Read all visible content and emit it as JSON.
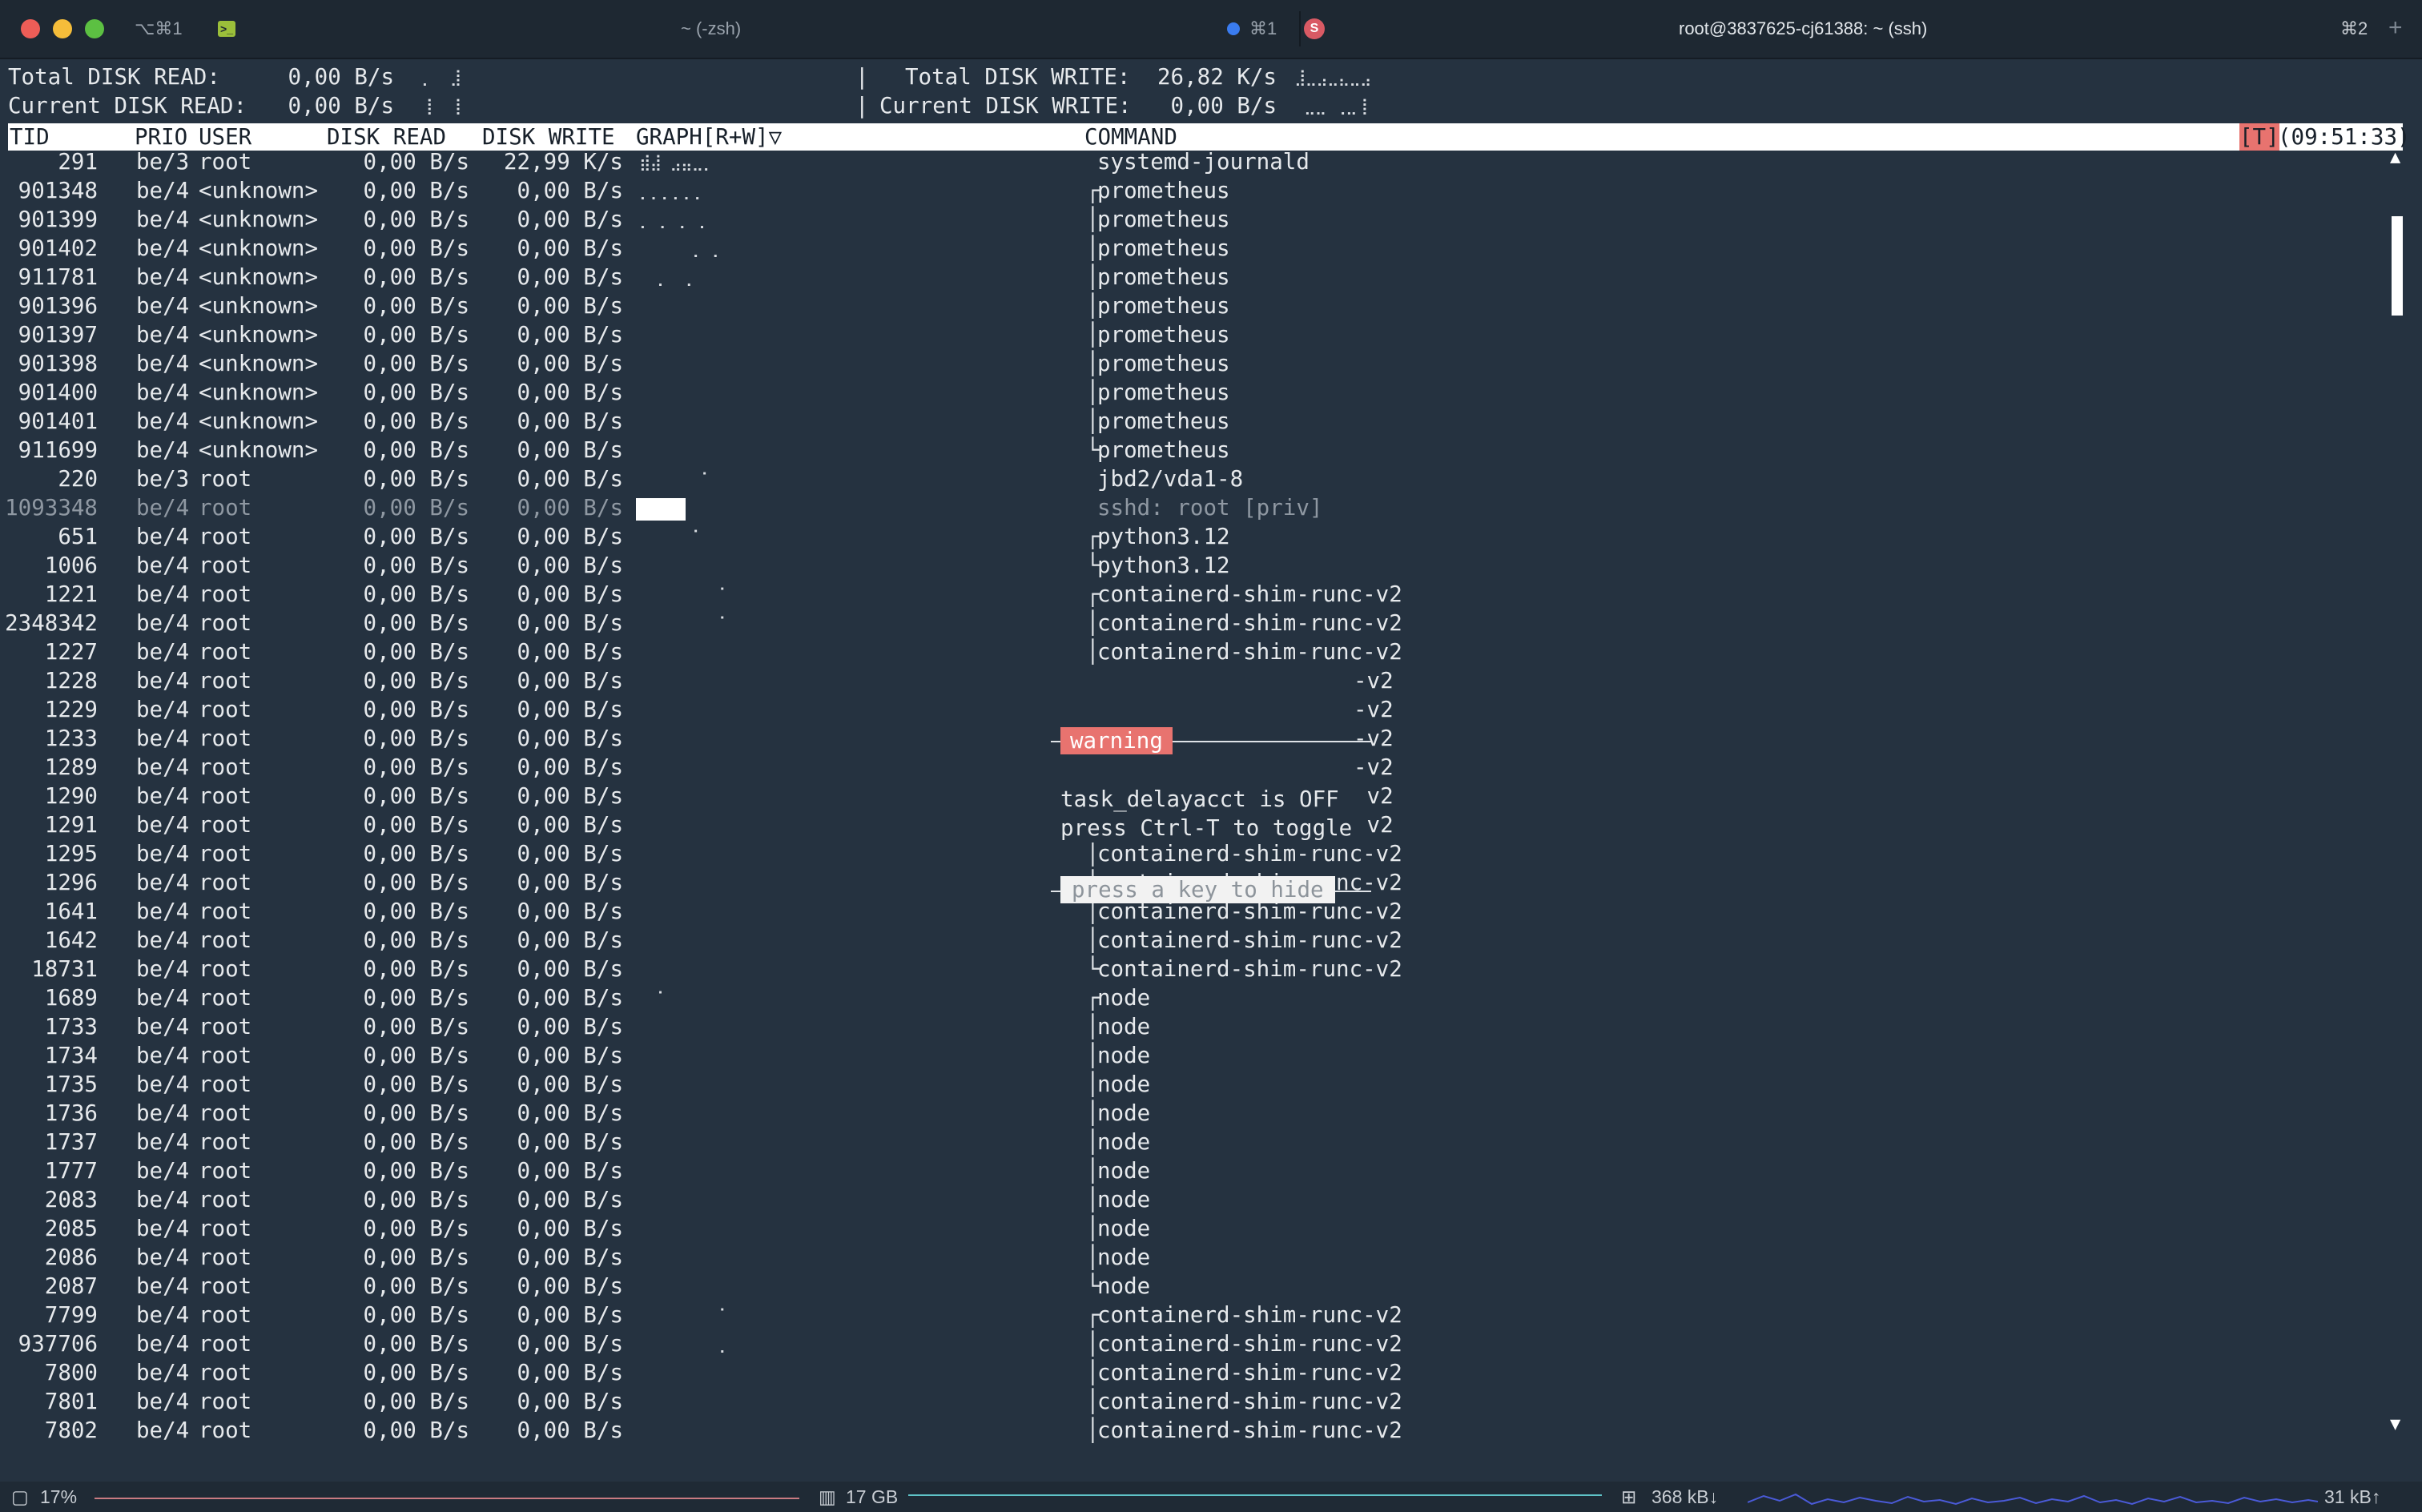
{
  "window": {
    "tab1": {
      "shortcut": "⌥⌘1",
      "title": "~ (-zsh)",
      "badge": "⌘1"
    },
    "tab2": {
      "title": "root@3837625-cj61388: ~ (ssh)",
      "badge": "⌘2"
    },
    "add_tab": "+"
  },
  "summary": {
    "total_read_label": "Total DISK READ:",
    "total_read": "0,00 B/s",
    "current_read_label": "Current DISK READ:",
    "current_read": "0,00 B/s",
    "total_write_label": "Total DISK WRITE:",
    "total_write": "26,82 K/s",
    "current_write_label": "Current DISK WRITE:",
    "current_write": "0,00 B/s",
    "sep": "|"
  },
  "header": {
    "tid": "TID",
    "prio": "PRIO",
    "user": "USER",
    "disk_read": "DISK READ",
    "disk_write": "DISK WRITE",
    "graph": "GRAPH[R+W]▽",
    "command": "COMMAND",
    "toggle": "[T]",
    "time": "(09:51:33)"
  },
  "rows": [
    {
      "tid": "291",
      "prio": "be/3",
      "user": "root",
      "read": "0,00 B/s",
      "write": "22,99 K/s",
      "graph": "⣾⣼ ⣠⣤⣀⡀",
      "cmd": "systemd-journald",
      "tree": ""
    },
    {
      "tid": "901348",
      "prio": "be/4",
      "user": "<unknown>",
      "read": "0,00 B/s",
      "write": "0,00 B/s",
      "graph": "⡀⡀⡀⡀⡀⡀",
      "cmd": "prometheus",
      "tree": "┌"
    },
    {
      "tid": "901399",
      "prio": "be/4",
      "user": "<unknown>",
      "read": "0,00 B/s",
      "write": "0,00 B/s",
      "graph": "⡀ ⡀ ⡀ ⡀",
      "cmd": "prometheus",
      "tree": "│"
    },
    {
      "tid": "901402",
      "prio": "be/4",
      "user": "<unknown>",
      "read": "0,00 B/s",
      "write": "0,00 B/s",
      "graph": "      ⡀ ⡀",
      "cmd": "prometheus",
      "tree": "│"
    },
    {
      "tid": "911781",
      "prio": "be/4",
      "user": "<unknown>",
      "read": "0,00 B/s",
      "write": "0,00 B/s",
      "graph": "  ⡀  ⡀",
      "cmd": "prometheus",
      "tree": "│"
    },
    {
      "tid": "901396",
      "prio": "be/4",
      "user": "<unknown>",
      "read": "0,00 B/s",
      "write": "0,00 B/s",
      "graph": "",
      "cmd": "prometheus",
      "tree": "│"
    },
    {
      "tid": "901397",
      "prio": "be/4",
      "user": "<unknown>",
      "read": "0,00 B/s",
      "write": "0,00 B/s",
      "graph": "",
      "cmd": "prometheus",
      "tree": "│"
    },
    {
      "tid": "901398",
      "prio": "be/4",
      "user": "<unknown>",
      "read": "0,00 B/s",
      "write": "0,00 B/s",
      "graph": "",
      "cmd": "prometheus",
      "tree": "│"
    },
    {
      "tid": "901400",
      "prio": "be/4",
      "user": "<unknown>",
      "read": "0,00 B/s",
      "write": "0,00 B/s",
      "graph": "",
      "cmd": "prometheus",
      "tree": "│"
    },
    {
      "tid": "901401",
      "prio": "be/4",
      "user": "<unknown>",
      "read": "0,00 B/s",
      "write": "0,00 B/s",
      "graph": "",
      "cmd": "prometheus",
      "tree": "│"
    },
    {
      "tid": "911699",
      "prio": "be/4",
      "user": "<unknown>",
      "read": "0,00 B/s",
      "write": "0,00 B/s",
      "graph": "",
      "cmd": "prometheus",
      "tree": "└"
    },
    {
      "tid": "220",
      "prio": "be/3",
      "user": "root",
      "read": "0,00 B/s",
      "write": "0,00 B/s",
      "graph": "       ⠁",
      "cmd": "jbd2/vda1-8",
      "tree": ""
    },
    {
      "tid": "1093348",
      "prio": "be/4",
      "user": "root",
      "read": "0,00 B/s",
      "write": "0,00 B/s",
      "graph": "",
      "cmd": "sshd: root [priv]",
      "tree": "",
      "dim": true,
      "block": true
    },
    {
      "tid": "651",
      "prio": "be/4",
      "user": "root",
      "read": "0,00 B/s",
      "write": "0,00 B/s",
      "graph": "      ⠁",
      "cmd": "python3.12",
      "tree": "┌"
    },
    {
      "tid": "1006",
      "prio": "be/4",
      "user": "root",
      "read": "0,00 B/s",
      "write": "0,00 B/s",
      "graph": "",
      "cmd": "python3.12",
      "tree": "└"
    },
    {
      "tid": "1221",
      "prio": "be/4",
      "user": "root",
      "read": "0,00 B/s",
      "write": "0,00 B/s",
      "graph": "         ⠁",
      "cmd": "containerd-shim-runc-v2",
      "tree": "┌"
    },
    {
      "tid": "2348342",
      "prio": "be/4",
      "user": "root",
      "read": "0,00 B/s",
      "write": "0,00 B/s",
      "graph": "         ⠁",
      "cmd": "containerd-shim-runc-v2",
      "tree": "│"
    },
    {
      "tid": "1227",
      "prio": "be/4",
      "user": "root",
      "read": "0,00 B/s",
      "write": "0,00 B/s",
      "graph": "",
      "cmd": "containerd-shim-runc-v2",
      "tree": "│"
    },
    {
      "tid": "1228",
      "prio": "be/4",
      "user": "root",
      "read": "0,00 B/s",
      "write": "0,00 B/s",
      "graph": "",
      "cmd": "-v2",
      "tree": "",
      "popup": true
    },
    {
      "tid": "1229",
      "prio": "be/4",
      "user": "root",
      "read": "0,00 B/s",
      "write": "0,00 B/s",
      "graph": "",
      "cmd": "-v2",
      "tree": "",
      "popup": true
    },
    {
      "tid": "1233",
      "prio": "be/4",
      "user": "root",
      "read": "0,00 B/s",
      "write": "0,00 B/s",
      "graph": "",
      "cmd": "-v2",
      "tree": "",
      "popup": true
    },
    {
      "tid": "1289",
      "prio": "be/4",
      "user": "root",
      "read": "0,00 B/s",
      "write": "0,00 B/s",
      "graph": "",
      "cmd": "-v2",
      "tree": "",
      "popup": true
    },
    {
      "tid": "1290",
      "prio": "be/4",
      "user": "root",
      "read": "0,00 B/s",
      "write": "0,00 B/s",
      "graph": "",
      "cmd": "-v2",
      "tree": "",
      "popup": true
    },
    {
      "tid": "1291",
      "prio": "be/4",
      "user": "root",
      "read": "0,00 B/s",
      "write": "0,00 B/s",
      "graph": "",
      "cmd": "-v2",
      "tree": "",
      "popup": true
    },
    {
      "tid": "1295",
      "prio": "be/4",
      "user": "root",
      "read": "0,00 B/s",
      "write": "0,00 B/s",
      "graph": "",
      "cmd": "containerd-shim-runc-v2",
      "tree": "│"
    },
    {
      "tid": "1296",
      "prio": "be/4",
      "user": "root",
      "read": "0,00 B/s",
      "write": "0,00 B/s",
      "graph": "",
      "cmd": "containerd-shim-runc-v2",
      "tree": "│"
    },
    {
      "tid": "1641",
      "prio": "be/4",
      "user": "root",
      "read": "0,00 B/s",
      "write": "0,00 B/s",
      "graph": "",
      "cmd": "containerd-shim-runc-v2",
      "tree": "│"
    },
    {
      "tid": "1642",
      "prio": "be/4",
      "user": "root",
      "read": "0,00 B/s",
      "write": "0,00 B/s",
      "graph": "",
      "cmd": "containerd-shim-runc-v2",
      "tree": "│"
    },
    {
      "tid": "18731",
      "prio": "be/4",
      "user": "root",
      "read": "0,00 B/s",
      "write": "0,00 B/s",
      "graph": "",
      "cmd": "containerd-shim-runc-v2",
      "tree": "└"
    },
    {
      "tid": "1689",
      "prio": "be/4",
      "user": "root",
      "read": "0,00 B/s",
      "write": "0,00 B/s",
      "graph": "  ⠁",
      "cmd": "node",
      "tree": "┌"
    },
    {
      "tid": "1733",
      "prio": "be/4",
      "user": "root",
      "read": "0,00 B/s",
      "write": "0,00 B/s",
      "graph": "",
      "cmd": "node",
      "tree": "│"
    },
    {
      "tid": "1734",
      "prio": "be/4",
      "user": "root",
      "read": "0,00 B/s",
      "write": "0,00 B/s",
      "graph": "",
      "cmd": "node",
      "tree": "│"
    },
    {
      "tid": "1735",
      "prio": "be/4",
      "user": "root",
      "read": "0,00 B/s",
      "write": "0,00 B/s",
      "graph": "",
      "cmd": "node",
      "tree": "│"
    },
    {
      "tid": "1736",
      "prio": "be/4",
      "user": "root",
      "read": "0,00 B/s",
      "write": "0,00 B/s",
      "graph": "",
      "cmd": "node",
      "tree": "│"
    },
    {
      "tid": "1737",
      "prio": "be/4",
      "user": "root",
      "read": "0,00 B/s",
      "write": "0,00 B/s",
      "graph": "",
      "cmd": "node",
      "tree": "│"
    },
    {
      "tid": "1777",
      "prio": "be/4",
      "user": "root",
      "read": "0,00 B/s",
      "write": "0,00 B/s",
      "graph": "",
      "cmd": "node",
      "tree": "│"
    },
    {
      "tid": "2083",
      "prio": "be/4",
      "user": "root",
      "read": "0,00 B/s",
      "write": "0,00 B/s",
      "graph": "",
      "cmd": "node",
      "tree": "│"
    },
    {
      "tid": "2085",
      "prio": "be/4",
      "user": "root",
      "read": "0,00 B/s",
      "write": "0,00 B/s",
      "graph": "",
      "cmd": "node",
      "tree": "│"
    },
    {
      "tid": "2086",
      "prio": "be/4",
      "user": "root",
      "read": "0,00 B/s",
      "write": "0,00 B/s",
      "graph": "",
      "cmd": "node",
      "tree": "│"
    },
    {
      "tid": "2087",
      "prio": "be/4",
      "user": "root",
      "read": "0,00 B/s",
      "write": "0,00 B/s",
      "graph": "",
      "cmd": "node",
      "tree": "└"
    },
    {
      "tid": "7799",
      "prio": "be/4",
      "user": "root",
      "read": "0,00 B/s",
      "write": "0,00 B/s",
      "graph": "         ⠁",
      "cmd": "containerd-shim-runc-v2",
      "tree": "┌"
    },
    {
      "tid": "937706",
      "prio": "be/4",
      "user": "root",
      "read": "0,00 B/s",
      "write": "0,00 B/s",
      "graph": "         ⡀",
      "cmd": "containerd-shim-runc-v2",
      "tree": "│"
    },
    {
      "tid": "7800",
      "prio": "be/4",
      "user": "root",
      "read": "0,00 B/s",
      "write": "0,00 B/s",
      "graph": "",
      "cmd": "containerd-shim-runc-v2",
      "tree": "│"
    },
    {
      "tid": "7801",
      "prio": "be/4",
      "user": "root",
      "read": "0,00 B/s",
      "write": "0,00 B/s",
      "graph": "",
      "cmd": "containerd-shim-runc-v2",
      "tree": "│"
    },
    {
      "tid": "7802",
      "prio": "be/4",
      "user": "root",
      "read": "0,00 B/s",
      "write": "0,00 B/s",
      "graph": "",
      "cmd": "containerd-shim-runc-v2",
      "tree": "│"
    }
  ],
  "popup": {
    "title": "warning",
    "line1": "task_delayacct is OFF",
    "line2": "press Ctrl-T to toggle",
    "hide": "press a key to hide"
  },
  "statusbar": {
    "cpu": "17%",
    "memory": "17 GB",
    "net_down": "368 kB↓",
    "net_up": "31 kB↑"
  },
  "colors": {
    "background": "#253240",
    "header_bg": "#ffffff",
    "warning_bg": "#e8736f",
    "net_graph": "#4a5ad8"
  }
}
